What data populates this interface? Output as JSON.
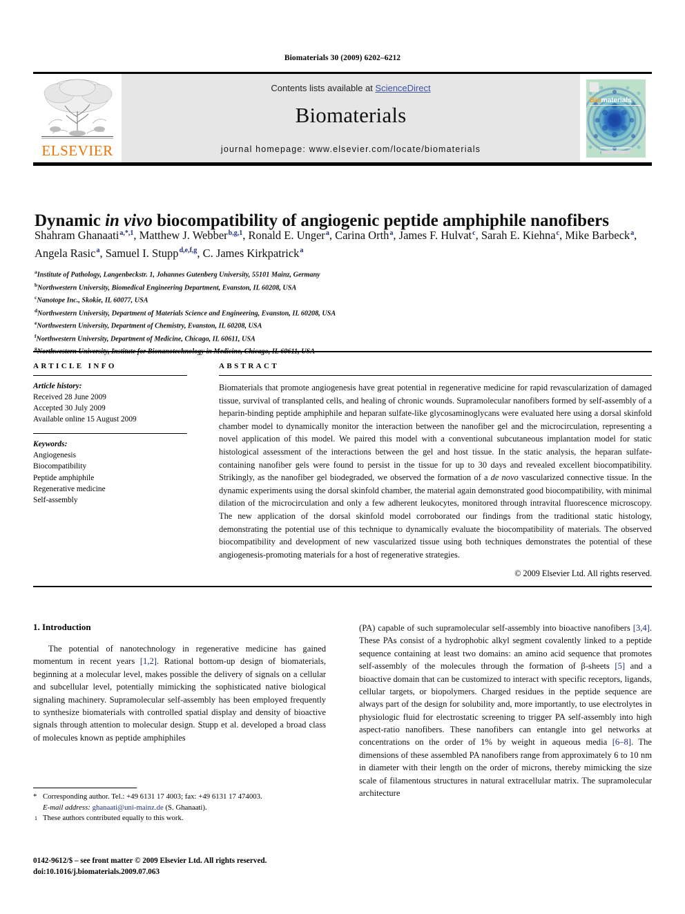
{
  "running_head": "Biomaterials 30 (2009) 6202–6212",
  "masthead": {
    "contents_prefix": "Contents lists available at ",
    "sciencedirect": "ScienceDirect",
    "journal_name": "Biomaterials",
    "homepage": "journal homepage: www.elsevier.com/locate/biomaterials",
    "publisher_logo_text": "ELSEVIER",
    "cover_title_part1": "Bio",
    "cover_title_part2": "materials",
    "link_color": "#3a53a4",
    "logo_color": "#ee7203"
  },
  "article": {
    "title_part1": "Dynamic ",
    "title_italic": "in vivo",
    "title_part2": " biocompatibility of angiogenic peptide amphiphile nanofibers",
    "authors": [
      {
        "name": "Shahram Ghanaati",
        "sup": "a,*,1",
        "sep": ", "
      },
      {
        "name": "Matthew J. Webber",
        "sup": "b,g,1",
        "sep": ", "
      },
      {
        "name": "Ronald E. Unger",
        "sup": "a",
        "sep": ", "
      },
      {
        "name": "Carina Orth",
        "sup": "a",
        "sep": ", "
      },
      {
        "name": "James F. Hulvat",
        "sup": "c",
        "sep": ", "
      },
      {
        "name": "Sarah E. Kiehna",
        "sup": "c",
        "sep": ", "
      },
      {
        "name": "Mike Barbeck",
        "sup": "a",
        "sep": ", "
      },
      {
        "name": "Angela Rasic",
        "sup": "a",
        "sep": ", "
      },
      {
        "name": "Samuel I. Stupp",
        "sup": "d,e,f,g",
        "sep": ", "
      },
      {
        "name": "C. James Kirkpatrick",
        "sup": "a",
        "sep": ""
      }
    ],
    "affiliations": [
      {
        "mark": "a",
        "text": "Institute of Pathology, Langenbeckstr. 1, Johannes Gutenberg University, 55101 Mainz, Germany"
      },
      {
        "mark": "b",
        "text": "Northwestern University, Biomedical Engineering Department, Evanston, IL 60208, USA"
      },
      {
        "mark": "c",
        "text": "Nanotope Inc., Skokie, IL 60077, USA"
      },
      {
        "mark": "d",
        "text": "Northwestern University, Department of Materials Science and Engineering, Evanston, IL 60208, USA"
      },
      {
        "mark": "e",
        "text": "Northwestern University, Department of Chemistry, Evanston, IL 60208, USA"
      },
      {
        "mark": "f",
        "text": "Northwestern University, Department of Medicine, Chicago, IL 60611, USA"
      },
      {
        "mark": "g",
        "text": "Northwestern University, Institute for Bionanotechnology in Medicine, Chicago, IL 60611, USA"
      }
    ]
  },
  "article_info": {
    "label": "ARTICLE INFO",
    "history_head": "Article history:",
    "history": [
      "Received 28 June 2009",
      "Accepted 30 July 2009",
      "Available online 15 August 2009"
    ],
    "keywords_head": "Keywords:",
    "keywords": [
      "Angiogenesis",
      "Biocompatibility",
      "Peptide amphiphile",
      "Regenerative medicine",
      "Self-assembly"
    ]
  },
  "abstract": {
    "label": "ABSTRACT",
    "part1": "Biomaterials that promote angiogenesis have great potential in regenerative medicine for rapid revascularization of damaged tissue, survival of transplanted cells, and healing of chronic wounds. Supramolecular nanofibers formed by self-assembly of a heparin-binding peptide amphiphile and heparan sulfate-like glycosaminoglycans were evaluated here using a dorsal skinfold chamber model to dynamically monitor the interaction between the nanofiber gel and the microcirculation, representing a novel application of this model. We paired this model with a conventional subcutaneous implantation model for static histological assessment of the interactions between the gel and host tissue. In the static analysis, the heparan sulfate-containing nanofiber gels were found to persist in the tissue for up to 30 days and revealed excellent biocompatibility. Strikingly, as the nanofiber gel biodegraded, we observed the formation of a ",
    "italic": "de novo",
    "part2": " vascularized connective tissue. In the dynamic experiments using the dorsal skinfold chamber, the material again demonstrated good biocompatibility, with minimal dilation of the microcirculation and only a few adherent leukocytes, monitored through intravital fluorescence microscopy. The new application of the dorsal skinfold model corroborated our findings from the traditional static histology, demonstrating the potential use of this technique to dynamically evaluate the biocompatibility of materials. The observed biocompatibility and development of new vascularized tissue using both techniques demonstrates the potential of these angiogenesis-promoting materials for a host of regenerative strategies.",
    "copyright": "© 2009 Elsevier Ltd. All rights reserved."
  },
  "body": {
    "section_heading": "1. Introduction",
    "left_paragraph_a": "The potential of nanotechnology in regenerative medicine has gained momentum in recent years ",
    "left_cite_1": "[1,2]",
    "left_paragraph_b": ". Rational bottom-up design of biomaterials, beginning at a molecular level, makes possible the delivery of signals on a cellular and subcellular level, potentially mimicking the sophisticated native biological signaling machinery. Supramolecular self-assembly has been employed frequently to synthesize biomaterials with controlled spatial display and density of bioactive signals through attention to molecular design. Stupp et al. developed a broad class of molecules known as peptide amphiphiles",
    "right_a": "(PA) capable of such supramolecular self-assembly into bioactive nanofibers ",
    "right_cite_1": "[3,4]",
    "right_b": ". These PAs consist of a hydrophobic alkyl segment covalently linked to a peptide sequence containing at least two domains: an amino acid sequence that promotes self-assembly of the molecules through the formation of β-sheets ",
    "right_cite_2": "[5]",
    "right_c": " and a bioactive domain that can be customized to interact with specific receptors, ligands, cellular targets, or biopolymers. Charged residues in the peptide sequence are always part of the design for solubility and, more importantly, to use electrolytes in physiologic fluid for electrostatic screening to trigger PA self-assembly into high aspect-ratio nanofibers. These nanofibers can entangle into gel networks at concentrations on the order of 1% by weight in aqueous media ",
    "right_cite_3": "[6–8]",
    "right_d": ". The dimensions of these assembled PA nanofibers range from approximately 6 to 10 nm in diameter with their length on the order of microns, thereby mimicking the size scale of filamentous structures in natural extracellular matrix. The supramolecular architecture"
  },
  "footnotes": {
    "corresponding_mark": "*",
    "corresponding_text": "Corresponding author. Tel.: +49 6131 17 4003; fax: +49 6131 17 474003.",
    "email_label": "E-mail address:",
    "email": "ghanaati@uni-mainz.de",
    "email_suffix": " (S. Ghanaati).",
    "equal_mark": "1",
    "equal_text": "These authors contributed equally to this work."
  },
  "imprint": {
    "line1": "0142-9612/$ – see front matter © 2009 Elsevier Ltd. All rights reserved.",
    "line2": "doi:10.1016/j.biomaterials.2009.07.063"
  }
}
